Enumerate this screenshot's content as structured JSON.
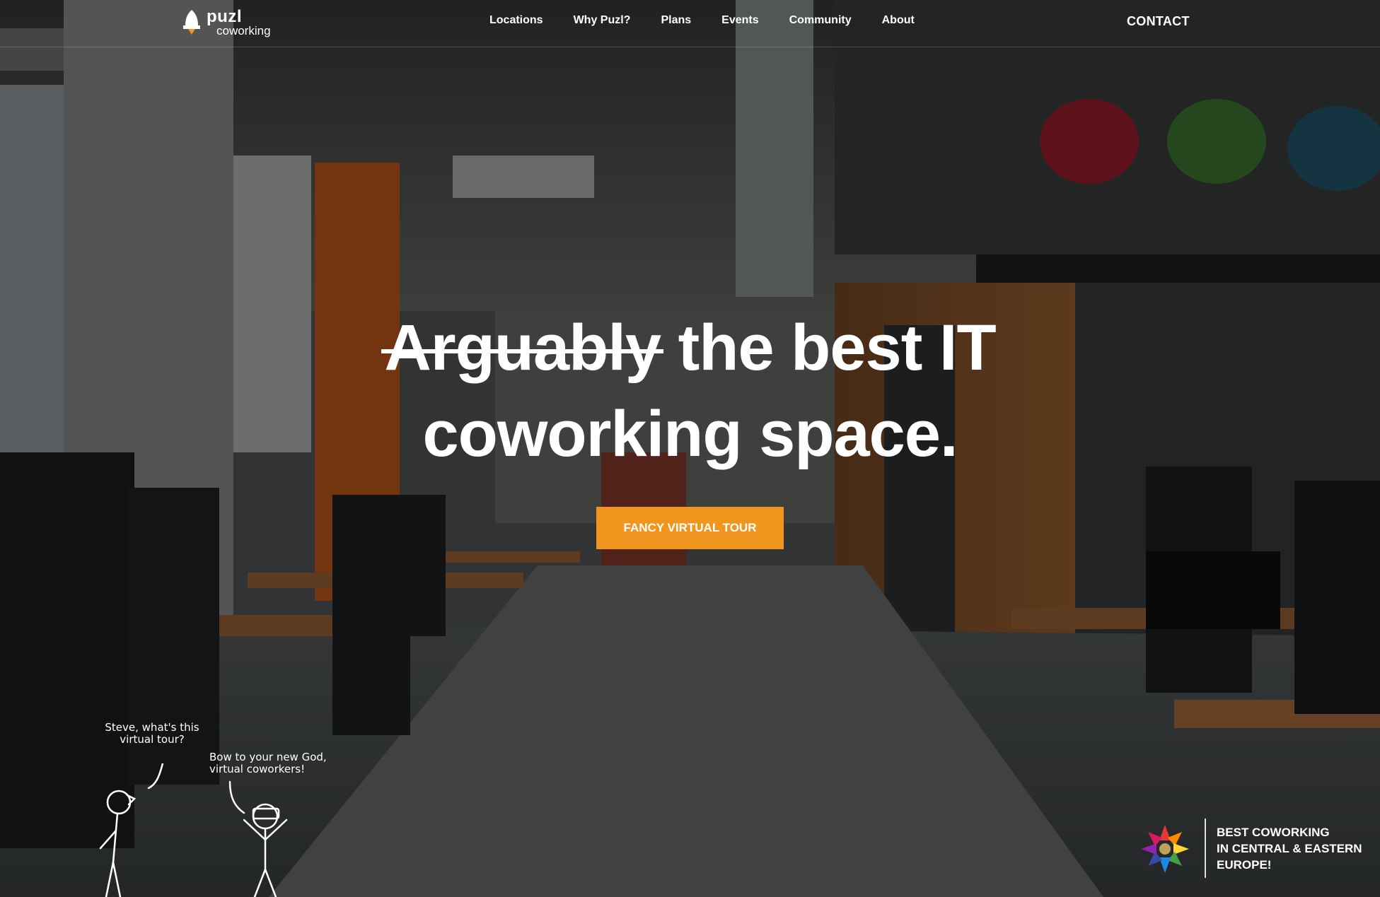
{
  "nav": {
    "logo_primary": "puzl",
    "logo_secondary": "coworking",
    "items": [
      "Locations",
      "Why Puzl?",
      "Plans",
      "Events",
      "Community",
      "About"
    ],
    "contact_label": "CONTACT"
  },
  "hero": {
    "headline_struck": "Arguably",
    "headline_rest": " the best IT",
    "headline_line2": "coworking space.",
    "cta_label": "FANCY VIRTUAL TOUR"
  },
  "doodle": {
    "bubble_left_line1": "Steve, what's this",
    "bubble_left_line2": "virtual tour?",
    "bubble_right_line1": "Bow to your new God,",
    "bubble_right_line2": "virtual coworkers!"
  },
  "award": {
    "line1": "BEST COWORKING",
    "line2": "IN CENTRAL & EASTERN",
    "line3": "EUROPE!"
  },
  "colors": {
    "accent": "#f0951d",
    "overlay": "#000000"
  },
  "icons": [
    "rocket-logo-icon",
    "award-star-icon"
  ]
}
